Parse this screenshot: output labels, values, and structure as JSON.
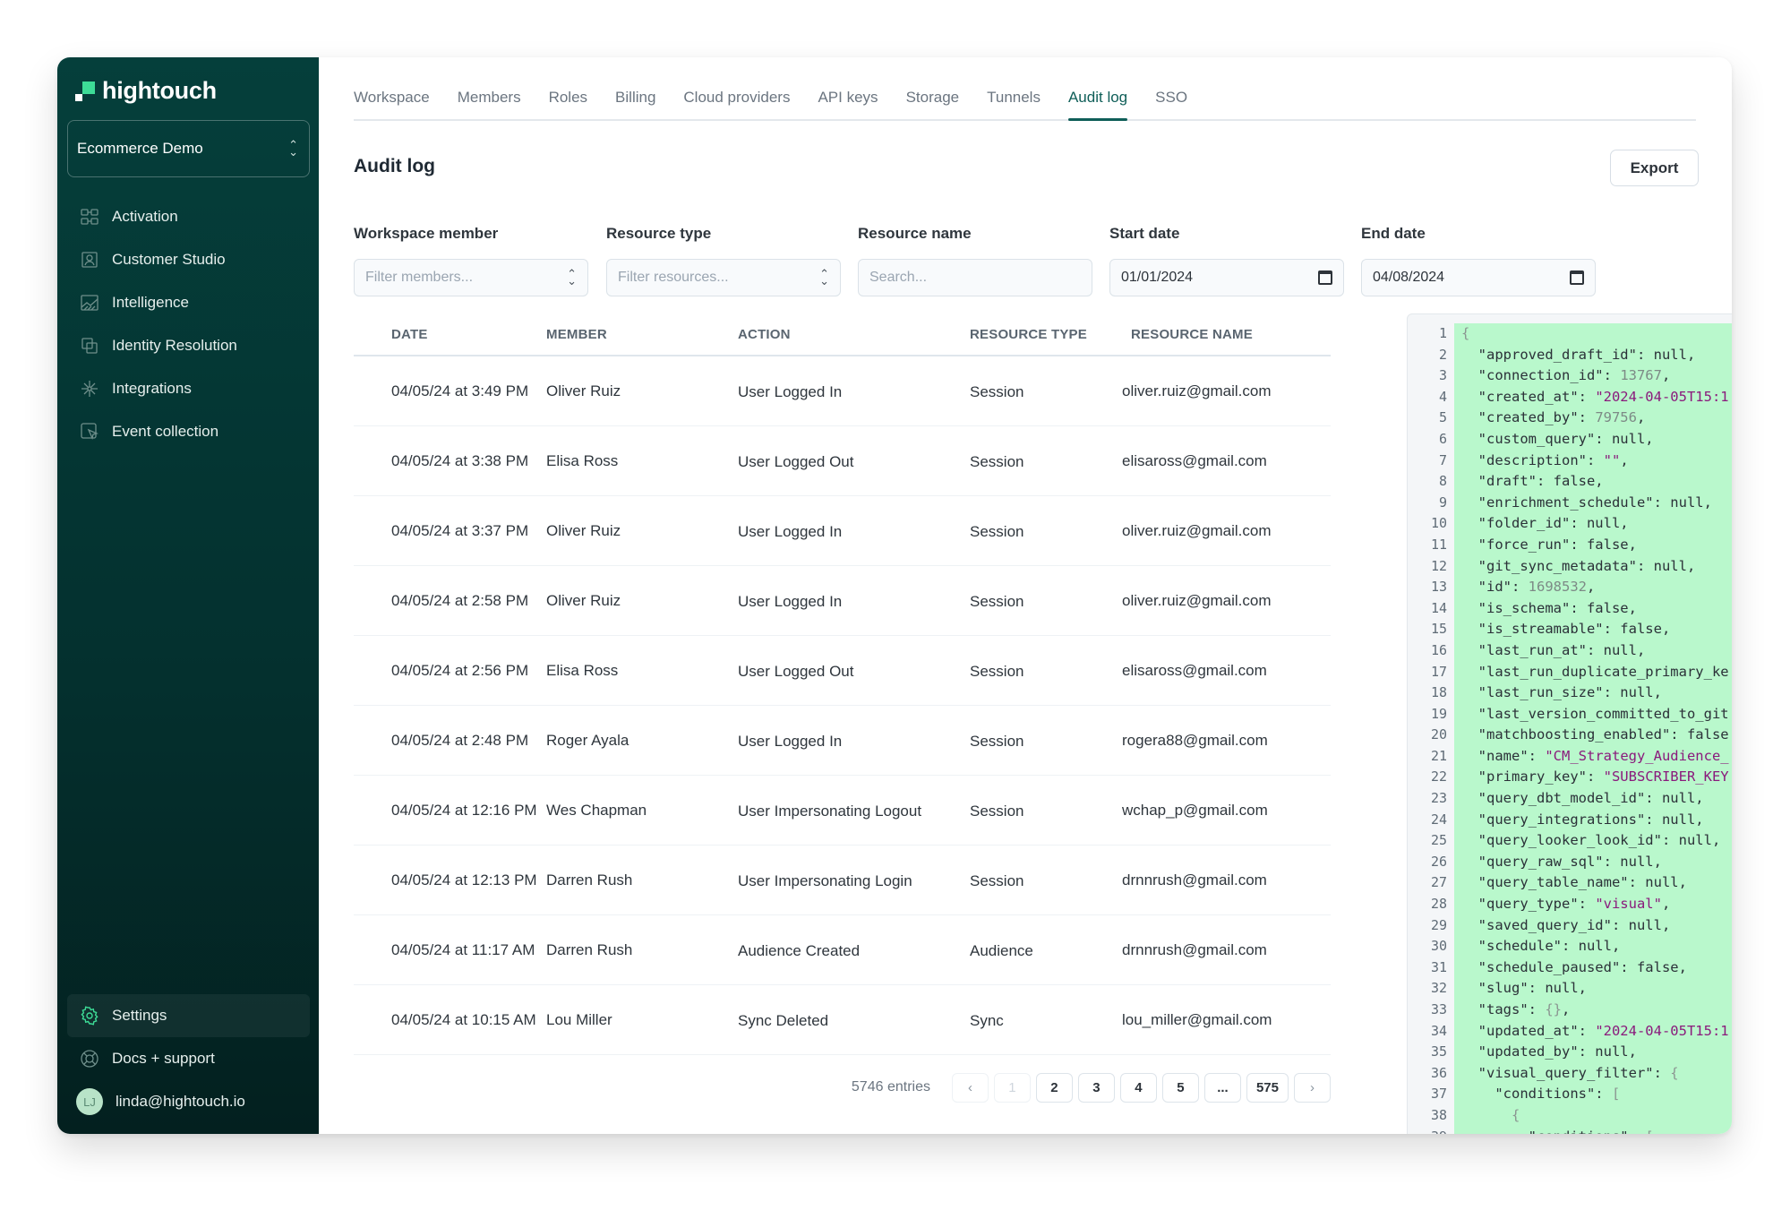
{
  "app": {
    "logo_text": "hightouch",
    "workspace": "Ecommerce Demo"
  },
  "sidebar": {
    "items": [
      {
        "label": "Activation",
        "icon": "activation-icon"
      },
      {
        "label": "Customer Studio",
        "icon": "customer-studio-icon"
      },
      {
        "label": "Intelligence",
        "icon": "intelligence-icon"
      },
      {
        "label": "Identity Resolution",
        "icon": "identity-resolution-icon"
      },
      {
        "label": "Integrations",
        "icon": "integrations-icon"
      },
      {
        "label": "Event collection",
        "icon": "event-collection-icon"
      }
    ],
    "bottom": {
      "settings": "Settings",
      "docs": "Docs + support",
      "user_email": "linda@hightouch.io",
      "user_initials": "LJ"
    }
  },
  "tabs": [
    {
      "label": "Workspace",
      "active": false
    },
    {
      "label": "Members",
      "active": false
    },
    {
      "label": "Roles",
      "active": false
    },
    {
      "label": "Billing",
      "active": false
    },
    {
      "label": "Cloud providers",
      "active": false
    },
    {
      "label": "API keys",
      "active": false
    },
    {
      "label": "Storage",
      "active": false
    },
    {
      "label": "Tunnels",
      "active": false
    },
    {
      "label": "Audit log",
      "active": true
    },
    {
      "label": "SSO",
      "active": false
    }
  ],
  "page": {
    "title": "Audit log",
    "export_label": "Export"
  },
  "filters": {
    "member": {
      "label": "Workspace member",
      "placeholder": "Filter members..."
    },
    "resource_type": {
      "label": "Resource type",
      "placeholder": "Filter resources..."
    },
    "resource_name": {
      "label": "Resource name",
      "placeholder": "Search..."
    },
    "start_date": {
      "label": "Start date",
      "value": "01/01/2024"
    },
    "end_date": {
      "label": "End date",
      "value": "04/08/2024"
    }
  },
  "table": {
    "columns": [
      "DATE",
      "MEMBER",
      "ACTION",
      "RESOURCE TYPE",
      "RESOURCE NAME"
    ],
    "rows": [
      [
        "04/05/24 at 3:49 PM",
        "Oliver Ruiz",
        "User Logged In",
        "Session",
        "oliver.ruiz@gmail.com"
      ],
      [
        "04/05/24 at 3:38 PM",
        "Elisa Ross",
        "User Logged Out",
        "Session",
        "elisaross@gmail.com"
      ],
      [
        "04/05/24 at 3:37 PM",
        "Oliver Ruiz",
        "User Logged In",
        "Session",
        "oliver.ruiz@gmail.com"
      ],
      [
        "04/05/24 at 2:58 PM",
        "Oliver Ruiz",
        "User Logged In",
        "Session",
        "oliver.ruiz@gmail.com"
      ],
      [
        "04/05/24 at 2:56 PM",
        "Elisa Ross",
        "User Logged Out",
        "Session",
        "elisaross@gmail.com"
      ],
      [
        "04/05/24 at 2:48 PM",
        "Roger Ayala",
        "User Logged In",
        "Session",
        "rogera88@gmail.com"
      ],
      [
        "04/05/24 at 12:16 PM",
        "Wes Chapman",
        "User Impersonating Logout",
        "Session",
        "wchap_p@gmail.com"
      ],
      [
        "04/05/24 at 12:13 PM",
        "Darren Rush",
        "User Impersonating Login",
        "Session",
        "drnnrush@gmail.com"
      ],
      [
        "04/05/24 at 11:17 AM",
        "Darren Rush",
        "Audience Created",
        "Audience",
        "drnnrush@gmail.com"
      ],
      [
        "04/05/24 at 10:15 AM",
        "Lou Miller",
        "Sync Deleted",
        "Sync",
        "lou_miller@gmail.com"
      ]
    ]
  },
  "pagination": {
    "entries": "5746 entries",
    "prev": "‹",
    "next": "›",
    "current_page": 1,
    "pages": [
      "1",
      "2",
      "3",
      "4",
      "5",
      "...",
      "575"
    ]
  },
  "json_viewer": {
    "lines": [
      [
        [
          "p",
          "{"
        ]
      ],
      [
        [
          "k",
          "  \"approved_draft_id\": "
        ],
        [
          "k",
          "null,"
        ]
      ],
      [
        [
          "k",
          "  \"connection_id\": "
        ],
        [
          "n",
          "13767"
        ],
        [
          "k",
          ","
        ]
      ],
      [
        [
          "k",
          "  \"created_at\": "
        ],
        [
          "s",
          "\"2024-04-05T15:1"
        ]
      ],
      [
        [
          "k",
          "  \"created_by\": "
        ],
        [
          "n",
          "79756"
        ],
        [
          "k",
          ","
        ]
      ],
      [
        [
          "k",
          "  \"custom_query\": null,"
        ]
      ],
      [
        [
          "k",
          "  \"description\": "
        ],
        [
          "s",
          "\"\""
        ],
        [
          "k",
          ","
        ]
      ],
      [
        [
          "k",
          "  \"draft\": false,"
        ]
      ],
      [
        [
          "k",
          "  \"enrichment_schedule\": null,"
        ]
      ],
      [
        [
          "k",
          "  \"folder_id\": null,"
        ]
      ],
      [
        [
          "k",
          "  \"force_run\": false,"
        ]
      ],
      [
        [
          "k",
          "  \"git_sync_metadata\": null,"
        ]
      ],
      [
        [
          "k",
          "  \"id\": "
        ],
        [
          "n",
          "1698532"
        ],
        [
          "k",
          ","
        ]
      ],
      [
        [
          "k",
          "  \"is_schema\": false,"
        ]
      ],
      [
        [
          "k",
          "  \"is_streamable\": false,"
        ]
      ],
      [
        [
          "k",
          "  \"last_run_at\": null,"
        ]
      ],
      [
        [
          "k",
          "  \"last_run_duplicate_primary_ke"
        ]
      ],
      [
        [
          "k",
          "  \"last_run_size\": null,"
        ]
      ],
      [
        [
          "k",
          "  \"last_version_committed_to_git"
        ]
      ],
      [
        [
          "k",
          "  \"matchboosting_enabled\": false"
        ]
      ],
      [
        [
          "k",
          "  \"name\": "
        ],
        [
          "s",
          "\"CM_Strategy_Audience_"
        ]
      ],
      [
        [
          "k",
          "  \"primary_key\": "
        ],
        [
          "s",
          "\"SUBSCRIBER_KEY"
        ]
      ],
      [
        [
          "k",
          "  \"query_dbt_model_id\": null,"
        ]
      ],
      [
        [
          "k",
          "  \"query_integrations\": null,"
        ]
      ],
      [
        [
          "k",
          "  \"query_looker_look_id\": null,"
        ]
      ],
      [
        [
          "k",
          "  \"query_raw_sql\": null,"
        ]
      ],
      [
        [
          "k",
          "  \"query_table_name\": null,"
        ]
      ],
      [
        [
          "k",
          "  \"query_type\": "
        ],
        [
          "s",
          "\"visual\""
        ],
        [
          "k",
          ","
        ]
      ],
      [
        [
          "k",
          "  \"saved_query_id\": null,"
        ]
      ],
      [
        [
          "k",
          "  \"schedule\": null,"
        ]
      ],
      [
        [
          "k",
          "  \"schedule_paused\": false,"
        ]
      ],
      [
        [
          "k",
          "  \"slug\": null,"
        ]
      ],
      [
        [
          "k",
          "  \"tags\": "
        ],
        [
          "p",
          "{}"
        ],
        [
          "k",
          ","
        ]
      ],
      [
        [
          "k",
          "  \"updated_at\": "
        ],
        [
          "s",
          "\"2024-04-05T15:1"
        ]
      ],
      [
        [
          "k",
          "  \"updated_by\": null,"
        ]
      ],
      [
        [
          "k",
          "  \"visual_query_filter\": "
        ],
        [
          "p",
          "{"
        ]
      ],
      [
        [
          "k",
          "    \"conditions\": "
        ],
        [
          "p",
          "["
        ]
      ],
      [
        [
          "p",
          "      {"
        ]
      ],
      [
        [
          "k",
          "        \"conditions\": "
        ],
        [
          "p",
          "["
        ]
      ]
    ]
  },
  "colors": {
    "sidebar_bg": "#053f3b",
    "brand_green": "#3ddc97",
    "accent": "#0f5e58",
    "json_bg": "#b9f8cc",
    "json_string": "#8a1a7c"
  }
}
